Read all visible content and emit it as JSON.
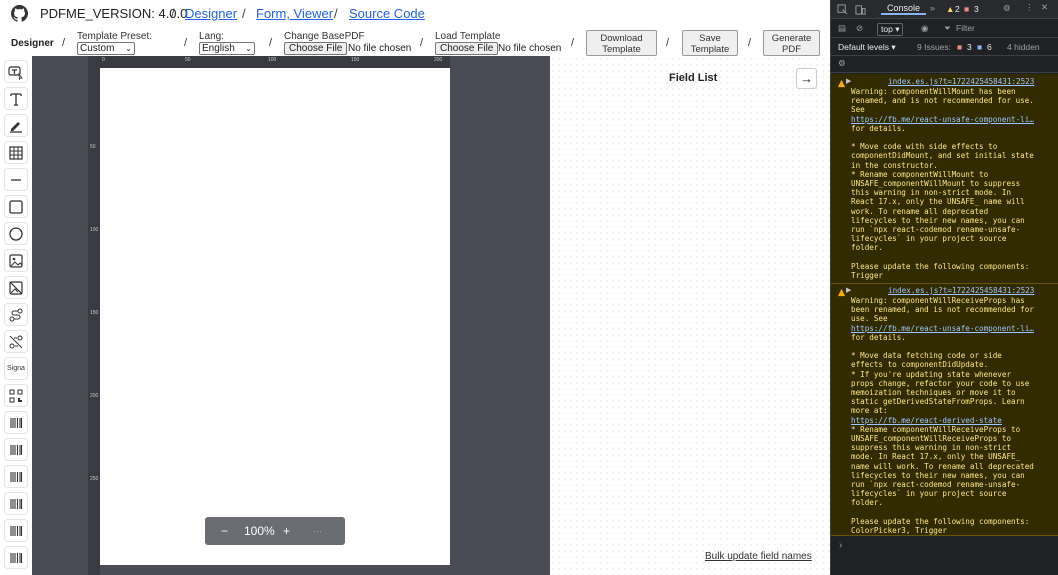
{
  "header": {
    "version": "PDFME_VERSION: 4.0.0",
    "sep": "/",
    "nav": [
      "Designer",
      "Form, Viewer",
      "Source Code"
    ]
  },
  "toolbar": {
    "title": "Designer",
    "template_preset_label": "Template Preset:",
    "template_preset_value": "Custom",
    "lang_label": "Lang:",
    "lang_value": "English",
    "base_pdf_label": "Change BasePDF",
    "load_template_label": "Load Template",
    "choose_file": "Choose File",
    "no_file": "No file chosen",
    "download_template": [
      "Download",
      "Template"
    ],
    "save_template": [
      "Save",
      "Template"
    ],
    "generate_pdf": [
      "Generate",
      "PDF"
    ]
  },
  "sidebar": {
    "tools": [
      "multivariable-text",
      "text",
      "signature",
      "table",
      "line",
      "rectangle",
      "ellipse",
      "image",
      "svg",
      "select",
      "checkbox",
      "signature-text",
      "qrcode",
      "barcode-1",
      "barcode-2",
      "barcode-3",
      "barcode-4",
      "barcode-5",
      "barcode-6"
    ],
    "signature_text": "Signa"
  },
  "ruler": {
    "top_ticks": [
      "0",
      "50",
      "100",
      "150",
      "200"
    ],
    "left_ticks": [
      "0",
      "50",
      "100",
      "150",
      "200",
      "250"
    ]
  },
  "zoom": {
    "minus": "−",
    "value": "100%",
    "plus": "+",
    "more": "···"
  },
  "right_panel": {
    "title": "Field List",
    "collapse_icon": "arrow-right-icon",
    "bulk_update": "Bulk update field names"
  },
  "devtools": {
    "console_tab": "Console",
    "more_tabs": "»",
    "warnings_badge": "2",
    "errors_badge": "3",
    "context": "top",
    "filter": "Filter",
    "levels": "Default levels ▾",
    "issues_label": "9 Issues:",
    "issues_red": "3",
    "issues_blue": "6",
    "hidden": "4 hidden",
    "messages": [
      {
        "source": "index.es.js?t=1722425458431:2523",
        "lines": [
          "Warning: componentWillMount has been",
          "renamed, and is not recommended for use.",
          "See",
          "https://fb.me/react-unsafe-component-li…",
          "for details.",
          "",
          "* Move code with side effects to",
          "componentDidMount, and set initial state",
          "in the constructor.",
          "* Rename componentWillMount to",
          "UNSAFE_componentWillMount to suppress",
          "this warning in non-strict mode. In",
          "React 17.x, only the UNSAFE_ name will",
          "work. To rename all deprecated",
          "lifecycles to their new names, you can",
          "run `npx react-codemod rename-unsafe-",
          "lifecycles` in your project source",
          "folder.",
          "",
          "Please update the following components:",
          "Trigger"
        ]
      },
      {
        "source": "index.es.js?t=1722425458431:2523",
        "lines": [
          "Warning: componentWillReceiveProps has",
          "been renamed, and is not recommended for",
          "use. See",
          "https://fb.me/react-unsafe-component-li…",
          "for details.",
          "",
          "* Move data fetching code or side",
          "effects to componentDidUpdate.",
          "* If you're updating state whenever",
          "props change, refactor your code to use",
          "memoization techniques or move it to",
          "static getDerivedStateFromProps. Learn",
          "more at:",
          "https://fb.me/react-derived-state",
          "* Rename componentWillReceiveProps to",
          "UNSAFE_componentWillReceiveProps to",
          "suppress this warning in non-strict",
          "mode. In React 17.x, only the UNSAFE_",
          "name will work. To rename all deprecated",
          "lifecycles to their new names, you can",
          "run `npx react-codemod rename-unsafe-",
          "lifecycles` in your project source",
          "folder.",
          "",
          "Please update the following components:",
          "ColorPicker3, Trigger"
        ]
      }
    ],
    "prompt": "›"
  },
  "colors": {
    "link": "#2563eb",
    "warn_bg": "#332b00",
    "warn_text": "#fce588",
    "canvas": "#4a4c55"
  }
}
